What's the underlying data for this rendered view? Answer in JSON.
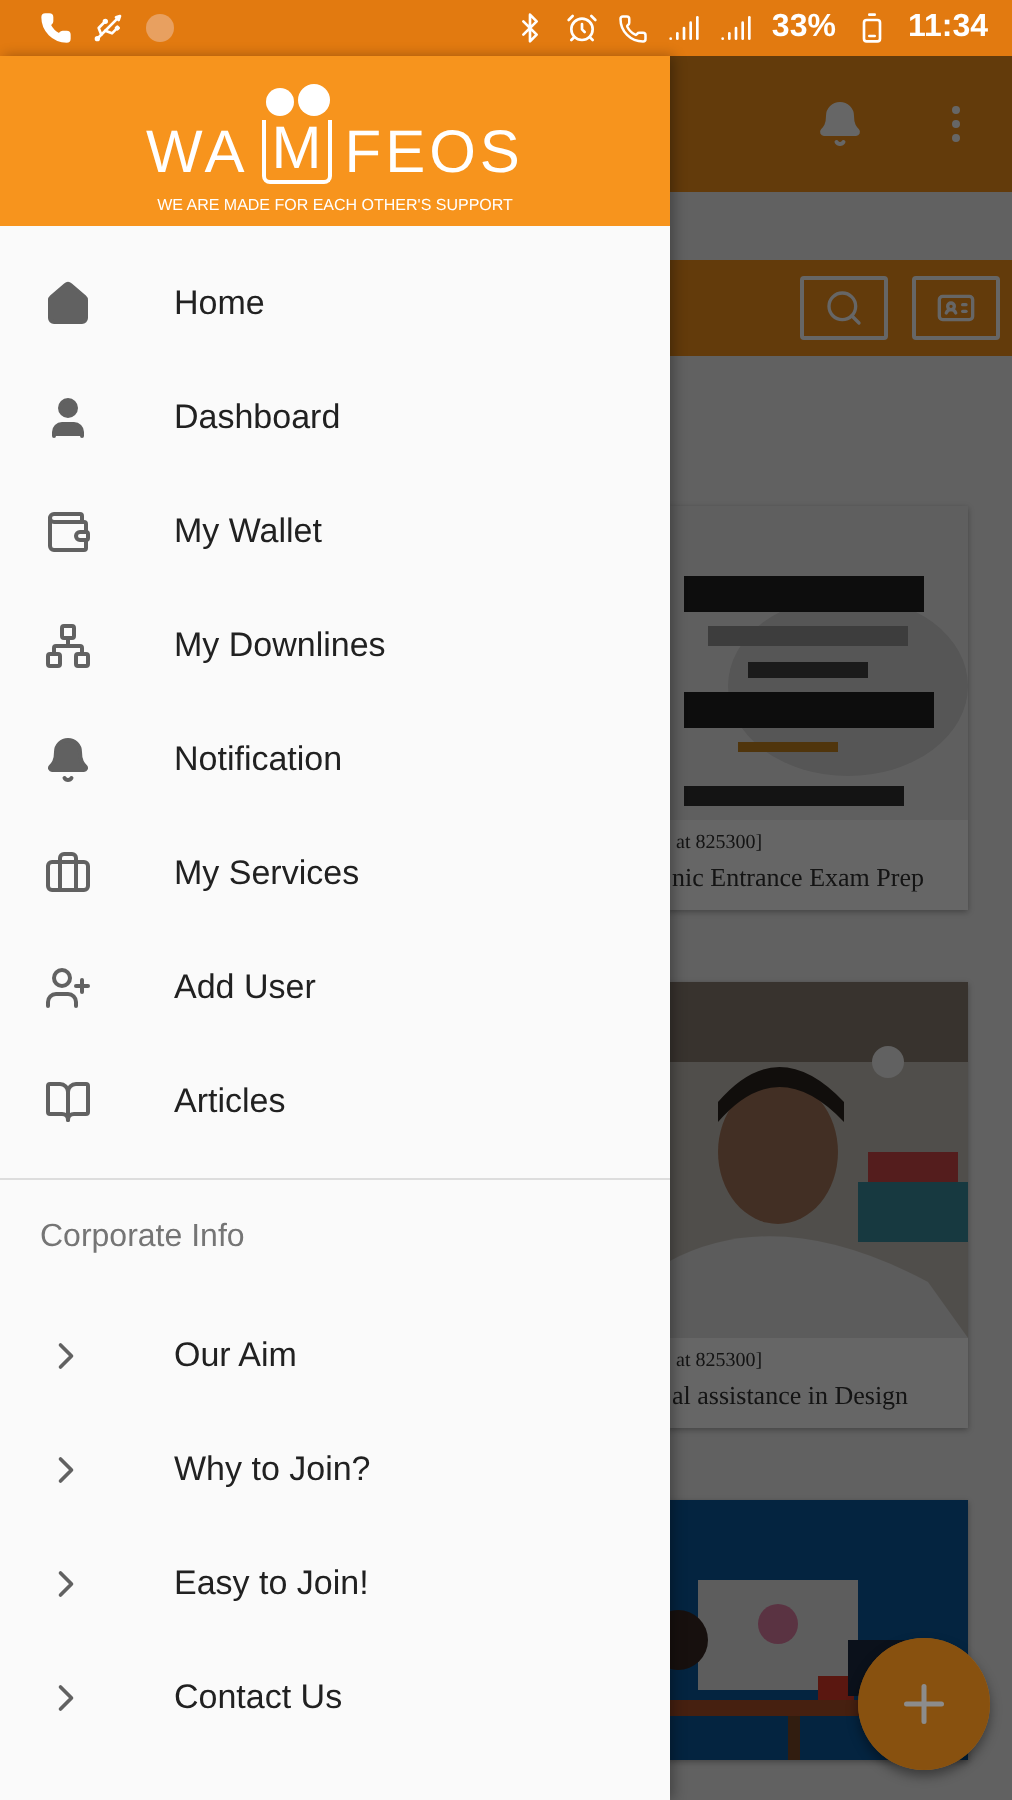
{
  "status_bar": {
    "battery": "33%",
    "time": "11:34"
  },
  "drawer": {
    "logo": {
      "left": "WA",
      "mark": "M",
      "right": "FEOS",
      "tagline": "WE ARE MADE FOR EACH OTHER'S SUPPORT"
    },
    "items": [
      {
        "label": "Home"
      },
      {
        "label": "Dashboard"
      },
      {
        "label": "My Wallet"
      },
      {
        "label": "My Downlines"
      },
      {
        "label": "Notification"
      },
      {
        "label": "My Services"
      },
      {
        "label": "Add User"
      },
      {
        "label": "Articles"
      }
    ],
    "section": {
      "title": "Corporate Info",
      "items": [
        {
          "label": "Our Aim"
        },
        {
          "label": "Why to Join?"
        },
        {
          "label": "Easy to Join!"
        },
        {
          "label": "Contact Us"
        }
      ]
    }
  },
  "background": {
    "cards": [
      {
        "kind": "poster",
        "caption": "at 825300]",
        "title": "nic Entrance Exam Prep"
      },
      {
        "caption": "at 825300]",
        "title": "al assistance in Design"
      },
      {
        "kind": "illustration"
      }
    ]
  }
}
